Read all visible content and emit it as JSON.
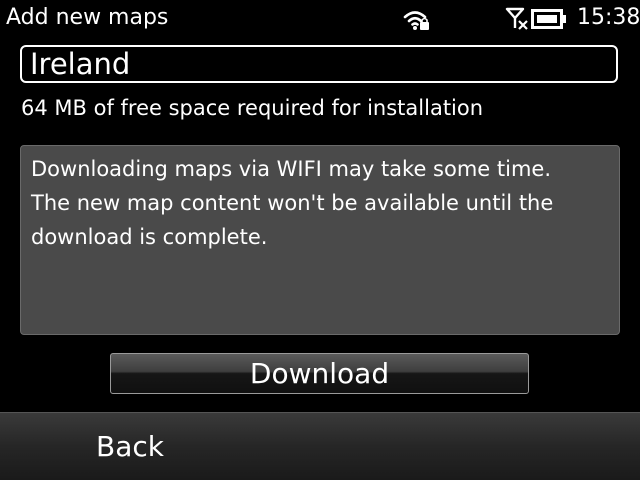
{
  "status_bar": {
    "title": "Add new maps",
    "time": "15:38",
    "icons": [
      "wifi-secured-icon",
      "no-signal-icon",
      "battery-full-icon"
    ]
  },
  "map_selection": {
    "region": "Ireland"
  },
  "space_note": "64 MB of free space required for installation",
  "info_box": {
    "lines": [
      "Downloading maps via WIFI may take some time.",
      "The new map content won't be available until the",
      "download is complete."
    ]
  },
  "download_button": {
    "label": "Download"
  },
  "softkeys": {
    "back_label": "Back"
  },
  "colors": {
    "background": "#000000",
    "text": "#ffffff",
    "info_box_bg": "#4a4a4a"
  }
}
